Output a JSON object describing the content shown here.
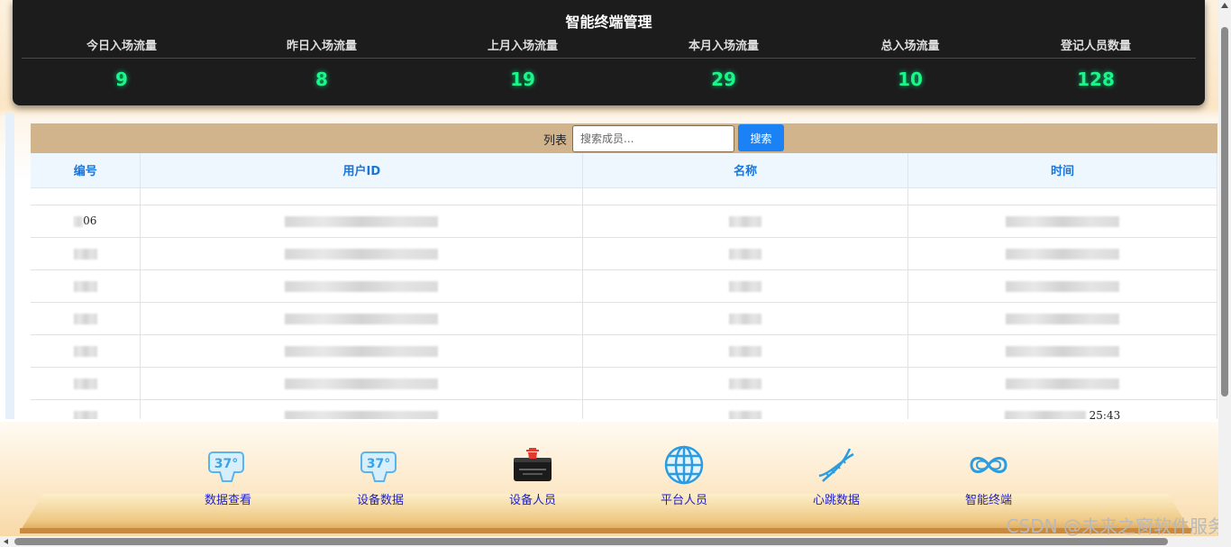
{
  "header": {
    "title": "智能终端管理",
    "stats": [
      {
        "label": "今日入场流量",
        "value": "9"
      },
      {
        "label": "昨日入场流量",
        "value": "8"
      },
      {
        "label": "上月入场流量",
        "value": "19"
      },
      {
        "label": "本月入场流量",
        "value": "29"
      },
      {
        "label": "总入场流量",
        "value": "10"
      },
      {
        "label": "登记人员数量",
        "value": "128"
      }
    ]
  },
  "list": {
    "title": "列表",
    "search_placeholder": "搜索成员...",
    "search_button": "搜索",
    "columns": [
      "编号",
      "用户ID",
      "名称",
      "时间"
    ],
    "rows": [
      {
        "id": "06",
        "time": ""
      },
      {
        "id": "",
        "time": ""
      },
      {
        "id": "",
        "time": ""
      },
      {
        "id": "",
        "time": ""
      },
      {
        "id": "",
        "time": ""
      },
      {
        "id": "",
        "time": ""
      },
      {
        "id": "",
        "time": "25:43"
      }
    ]
  },
  "nav": {
    "items": [
      {
        "label": "数据查看",
        "icon": "thermometer-37-icon"
      },
      {
        "label": "设备数据",
        "icon": "thermometer-37-icon"
      },
      {
        "label": "设备人员",
        "icon": "terminal-device-icon"
      },
      {
        "label": "平台人员",
        "icon": "globe-icon"
      },
      {
        "label": "心跳数据",
        "icon": "dna-icon"
      },
      {
        "label": "智能终端",
        "icon": "infinity-loop-icon"
      }
    ]
  },
  "watermark": "CSDN @未来之窗软件服务"
}
